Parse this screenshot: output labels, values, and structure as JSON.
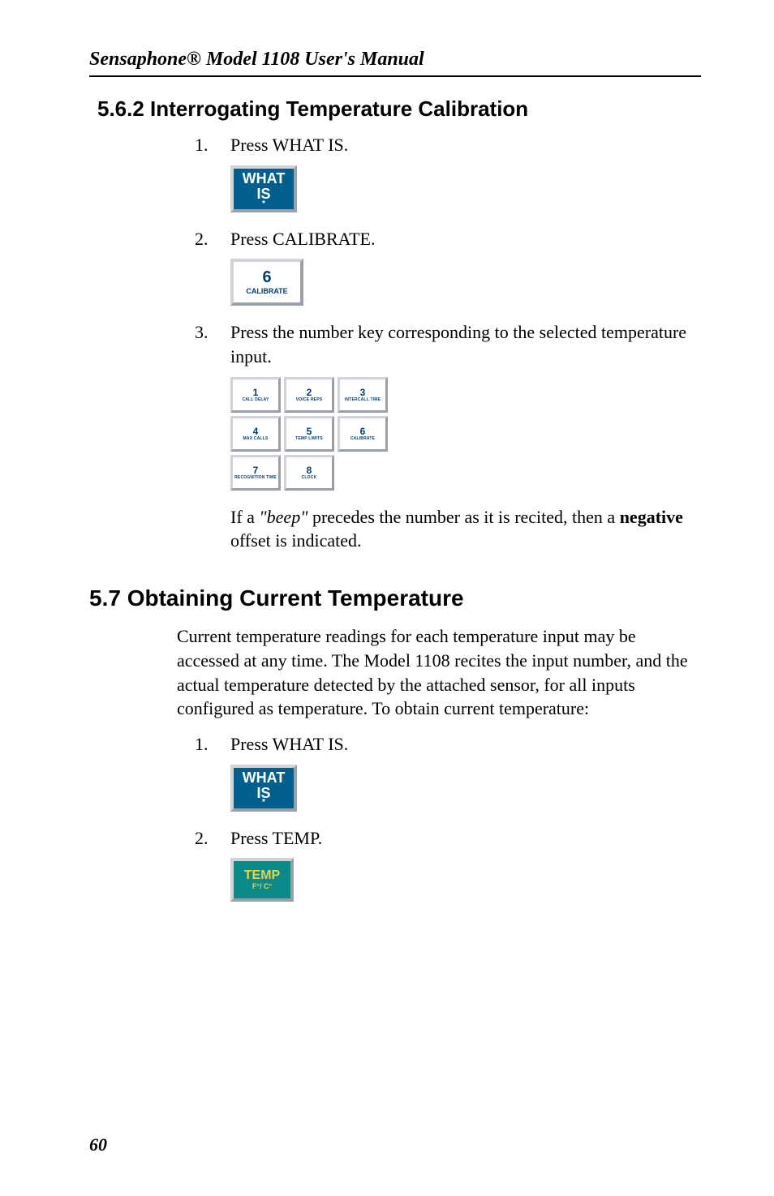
{
  "running_title": "Sensaphone® Model 1108 User's Manual",
  "sec562": {
    "heading": "5.6.2  Interrogating Temperature Calibration",
    "steps": [
      {
        "n": "1.",
        "t": "Press WHAT IS."
      },
      {
        "n": "2.",
        "t": "Press CALIBRATE."
      },
      {
        "n": "3.",
        "t": "Press the number key corresponding to the selected temperature input."
      }
    ],
    "note_pre": "If a ",
    "note_beep": "\"beep\"",
    "note_mid": " precedes the number as it is recited, then a ",
    "note_bold": "negative",
    "note_post": " offset is indicated."
  },
  "sec57": {
    "heading": "5.7  Obtaining Current Temperature",
    "para": "Current temperature readings for each temperature input may be accessed at any time. The Model 1108 recites the input number, and the actual temperature detected by the attached sensor, for all inputs configured as temperature. To obtain current temperature:",
    "steps": [
      {
        "n": "1.",
        "t": "Press WHAT IS."
      },
      {
        "n": "2.",
        "t": "Press TEMP."
      }
    ]
  },
  "buttons": {
    "whatis": {
      "l1": "WHAT",
      "l2": "IS",
      "star": "*"
    },
    "calibrate": {
      "big": "6",
      "sub": "CALIBRATE"
    },
    "temp": {
      "big": "TEMP",
      "sub": "F°/ C°"
    }
  },
  "keypad": [
    {
      "big": "1",
      "sub": "CALL DELAY"
    },
    {
      "big": "2",
      "sub": "VOICE REPS"
    },
    {
      "big": "3",
      "sub": "INTERCALL TIME"
    },
    {
      "big": "4",
      "sub": "MAX CALLS"
    },
    {
      "big": "5",
      "sub": "TEMP LIMITS"
    },
    {
      "big": "6",
      "sub": "CALIBRATE"
    },
    {
      "big": "7",
      "sub": "RECOGNITION TIME"
    },
    {
      "big": "8",
      "sub": "CLOCK"
    }
  ],
  "page_number": "60"
}
